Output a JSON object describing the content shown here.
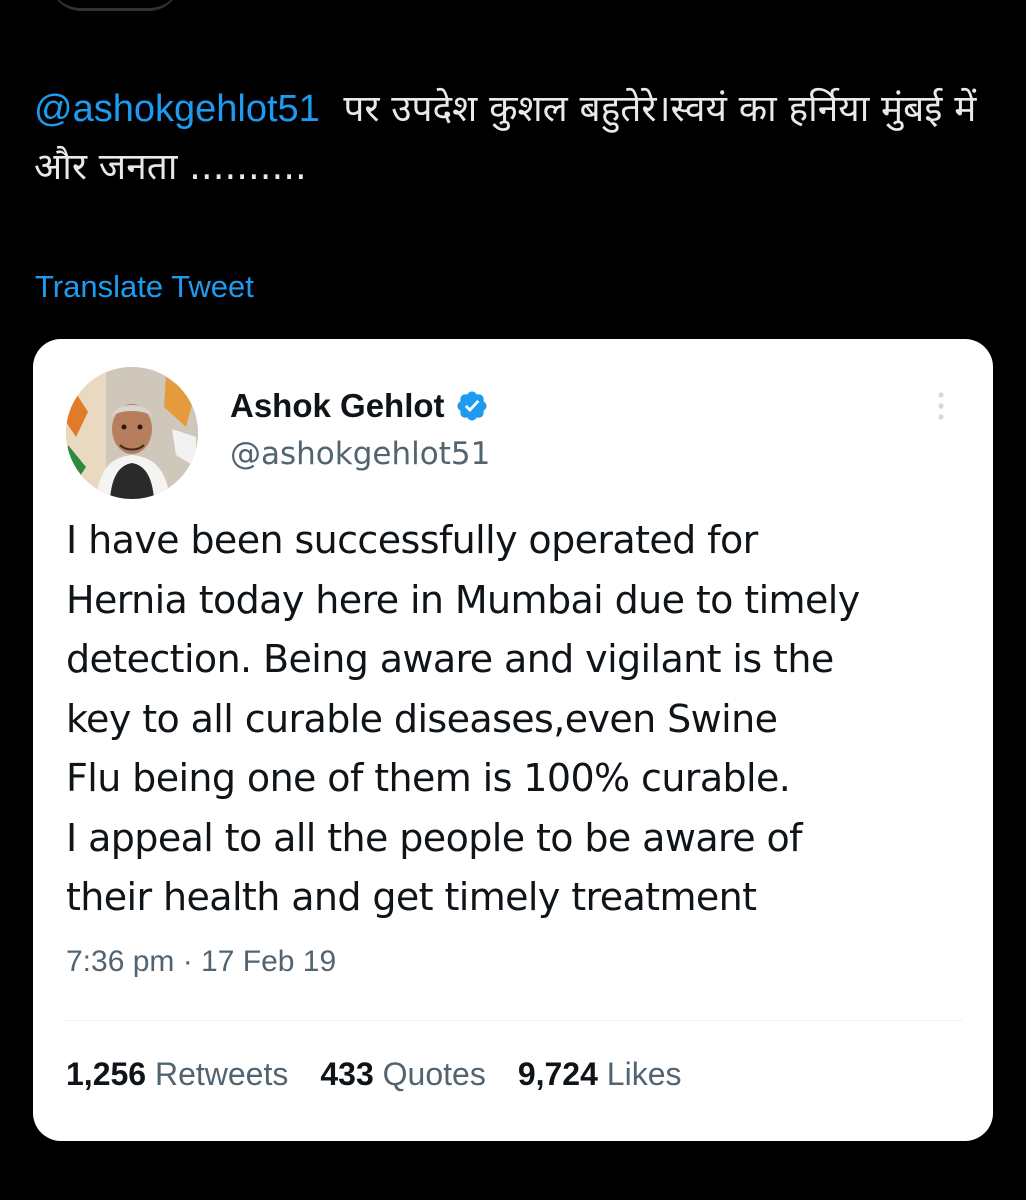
{
  "reply": {
    "mention": "@ashokgehlot51",
    "text": "पर उपदेश कुशल बहुतेरे।स्वयं का हर्निया मुंबई में और जनता ..........",
    "translate_label": "Translate Tweet"
  },
  "quoted_tweet": {
    "author_name": "Ashok Gehlot",
    "author_handle": "@ashokgehlot51",
    "verified": true,
    "avatar_icon": "profile-photo-avatar",
    "more_icon": "vertical-ellipsis-icon",
    "body": "I have been successfully operated for\nHernia today here in Mumbai due to timely\ndetection. Being aware and vigilant is the\nkey to all curable diseases,even Swine\nFlu being one of them is 100% curable.\nI appeal to all the people to be aware of\ntheir health and get timely treatment",
    "timestamp": "7:36 pm · 17 Feb 19",
    "stats": [
      {
        "count": "1,256",
        "label": "Retweets"
      },
      {
        "count": "433",
        "label": "Quotes"
      },
      {
        "count": "9,724",
        "label": "Likes"
      }
    ]
  },
  "colors": {
    "background": "#000000",
    "link": "#1d9bf0",
    "card_background": "#ffffff",
    "primary_text": "#0f1419",
    "secondary_text": "#536471",
    "verified_badge": "#1d9bf0"
  }
}
